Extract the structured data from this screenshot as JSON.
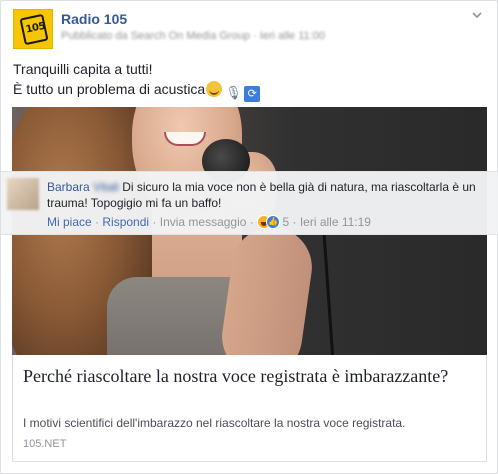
{
  "post": {
    "page_name": "Radio 105",
    "meta_text": "Pubblicato da Search On Media Group · Ieri alle 11:00",
    "avatar_logo_text": "105",
    "message_line1": "Tranquilli capita a tutti!",
    "message_line2": "È tutto un problema di acustica",
    "message_emoji": [
      "smile-icon",
      "microphone-icon",
      "repeat-arrows-icon"
    ]
  },
  "comment": {
    "author_first": "Barbara",
    "author_last": "Vitali",
    "text": "Di sicuro la mia voce non è bella già di natura, ma riascoltarla è un trauma! Topogigio mi fa un baffo!",
    "like_label": "Mi piace",
    "reply_label": "Rispondi",
    "message_label": "Invia messaggio",
    "reaction_count": "5",
    "timestamp": "Ieri alle 11:19",
    "separator": " · "
  },
  "link": {
    "title": "Perché riascoltare la nostra voce registrata è imbarazzante?",
    "description": "I motivi scientifici dell'imbarazzo nel riascoltare la nostra voce registrata.",
    "domain": "105.NET"
  },
  "colors": {
    "name_blue": "#365899",
    "action_blue": "#4267b2",
    "meta_gray": "#90949c",
    "logo_yellow": "#f7c600"
  }
}
